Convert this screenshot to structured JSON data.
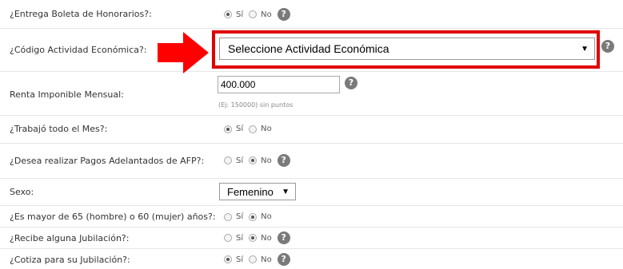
{
  "colors": {
    "highlight": "#e00000",
    "arrow": "#ff0000",
    "help_icon": "#7a7a7a"
  },
  "rows": {
    "boleta": {
      "label": "¿Entrega Boleta de Honorarios?:",
      "options": [
        "Sí",
        "No"
      ],
      "selected": "Sí"
    },
    "actividad": {
      "label": "¿Código Actividad Económica?:",
      "select_value": "Seleccione Actividad Económica"
    },
    "renta": {
      "label": "Renta Imponible Mensual:",
      "value": "400.000",
      "hint": "(Ej: 150000) sin puntos"
    },
    "mes": {
      "label": "¿Trabajó todo el Mes?:",
      "options": [
        "Sí",
        "No"
      ],
      "selected": "Sí"
    },
    "afp": {
      "label": "¿Desea realizar Pagos Adelantados de AFP?:",
      "options": [
        "Sí",
        "No"
      ],
      "selected": "No"
    },
    "sexo": {
      "label": "Sexo:",
      "select_value": "Femenino"
    },
    "mayor": {
      "label": "¿Es mayor de 65 (hombre) o 60 (mujer) años?:",
      "options": [
        "Sí",
        "No"
      ],
      "selected": "No"
    },
    "jubilacion": {
      "label": "¿Recibe alguna Jubilación?:",
      "options": [
        "Sí",
        "No"
      ],
      "selected": "No"
    },
    "cotiza": {
      "label": "¿Cotiza para su Jubilación?:",
      "options": [
        "Sí",
        "No"
      ],
      "selected": "Sí"
    }
  },
  "icons": {
    "help": "?",
    "caret": "▼",
    "arrow": "arrow-right-icon"
  }
}
